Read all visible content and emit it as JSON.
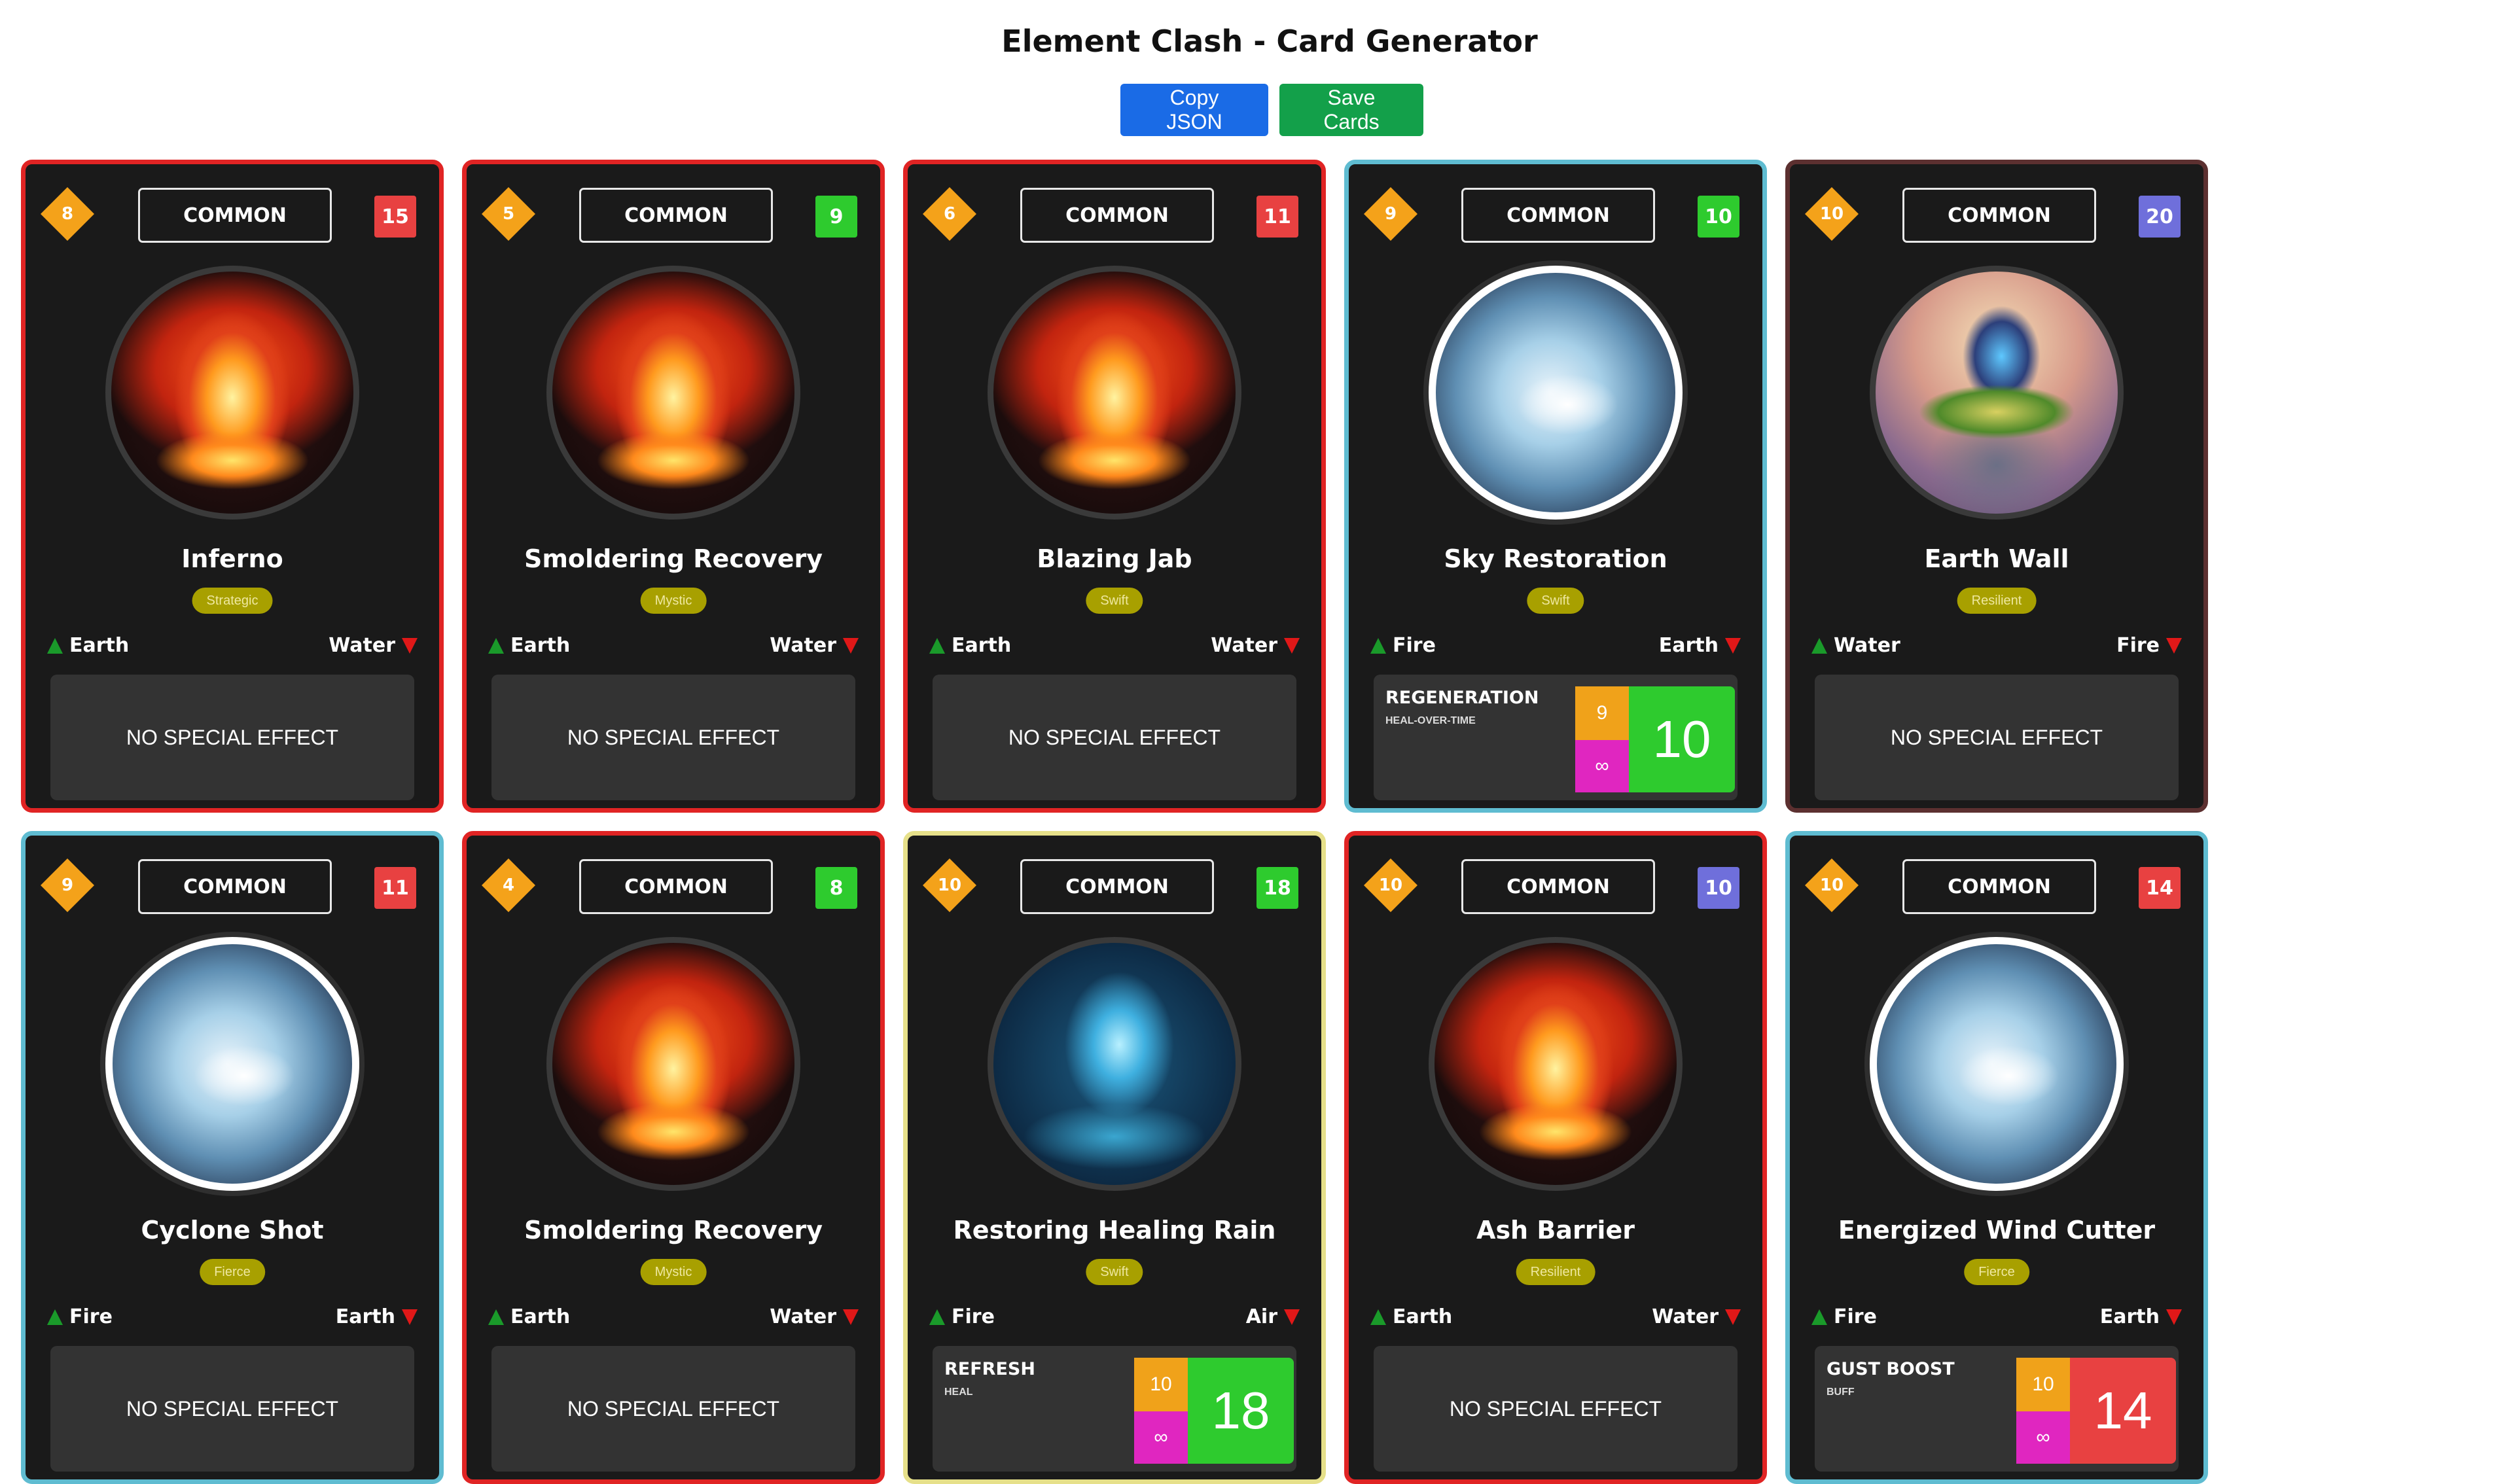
{
  "title": "Element Clash - Card Generator",
  "actions": {
    "copy_label": "Copy JSON",
    "save_label": "Save Cards"
  },
  "colors": {
    "power_red": "#e84141",
    "power_green": "#2ecb2e",
    "power_purple": "#6f6fdb",
    "border_red": "#e02424",
    "border_cyan": "#5fbcd1",
    "border_brown": "#5c3030",
    "border_yellow": "#e6e08a"
  },
  "cards": [
    {
      "cost": "8",
      "rarity": "COMMON",
      "power": "15",
      "power_color": "#e84141",
      "art": "fire-icon",
      "name": "Inferno",
      "trait": "Strategic",
      "strong": "Earth",
      "weak": "Water",
      "effect_none": "NO SPECIAL EFFECT"
    },
    {
      "cost": "5",
      "rarity": "COMMON",
      "power": "9",
      "power_color": "#2ecb2e",
      "art": "fire-icon",
      "name": "Smoldering Recovery",
      "trait": "Mystic",
      "strong": "Earth",
      "weak": "Water",
      "effect_none": "NO SPECIAL EFFECT"
    },
    {
      "cost": "6",
      "rarity": "COMMON",
      "power": "11",
      "power_color": "#e84141",
      "art": "fire-icon",
      "name": "Blazing Jab",
      "trait": "Swift",
      "strong": "Earth",
      "weak": "Water",
      "effect_none": "NO SPECIAL EFFECT"
    },
    {
      "cost": "9",
      "rarity": "COMMON",
      "power": "10",
      "power_color": "#2ecb2e",
      "art": "air-icon",
      "name": "Sky Restoration",
      "trait": "Swift",
      "strong": "Fire",
      "weak": "Earth",
      "effect": {
        "name": "REGENERATION",
        "type": "HEAL-OVER-TIME",
        "turns": "9",
        "duration": "∞",
        "value": "10",
        "value_color": "#2ecb2e"
      }
    },
    {
      "cost": "10",
      "rarity": "COMMON",
      "power": "20",
      "power_color": "#6f6fdb",
      "art": "earth-icon",
      "name": "Earth Wall",
      "trait": "Resilient",
      "strong": "Water",
      "weak": "Fire",
      "effect_none": "NO SPECIAL EFFECT"
    },
    {
      "cost": "9",
      "rarity": "COMMON",
      "power": "11",
      "power_color": "#e84141",
      "art": "air-icon",
      "name": "Cyclone Shot",
      "trait": "Fierce",
      "strong": "Fire",
      "weak": "Earth",
      "effect_none": "NO SPECIAL EFFECT"
    },
    {
      "cost": "4",
      "rarity": "COMMON",
      "power": "8",
      "power_color": "#2ecb2e",
      "art": "fire-icon",
      "name": "Smoldering Recovery",
      "trait": "Mystic",
      "strong": "Earth",
      "weak": "Water",
      "effect_none": "NO SPECIAL EFFECT"
    },
    {
      "cost": "10",
      "rarity": "COMMON",
      "power": "18",
      "power_color": "#2ecb2e",
      "art": "water-icon",
      "name": "Restoring Healing Rain",
      "trait": "Swift",
      "strong": "Fire",
      "weak": "Air",
      "effect": {
        "name": "REFRESH",
        "type": "HEAL",
        "turns": "10",
        "duration": "∞",
        "value": "18",
        "value_color": "#2ecb2e"
      }
    },
    {
      "cost": "10",
      "rarity": "COMMON",
      "power": "10",
      "power_color": "#6f6fdb",
      "art": "fire-icon",
      "name": "Ash Barrier",
      "trait": "Resilient",
      "strong": "Earth",
      "weak": "Water",
      "effect_none": "NO SPECIAL EFFECT"
    },
    {
      "cost": "10",
      "rarity": "COMMON",
      "power": "14",
      "power_color": "#e84141",
      "art": "air-icon",
      "name": "Energized Wind Cutter",
      "trait": "Fierce",
      "strong": "Fire",
      "weak": "Earth",
      "effect": {
        "name": "GUST BOOST",
        "type": "BUFF",
        "turns": "10",
        "duration": "∞",
        "value": "14",
        "value_color": "#e84141"
      }
    }
  ]
}
